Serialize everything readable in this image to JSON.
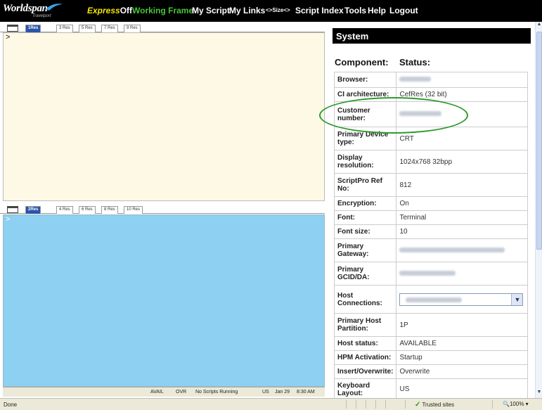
{
  "app": {
    "logo": "Worldspan",
    "logo_sub": "Travelport"
  },
  "nav": {
    "express_prefix": "Express",
    "express_state": "Off",
    "working_frame": "Working Frame",
    "my_script": "My Script",
    "my_links": "My Links",
    "size": "<>Size<>",
    "script_index": "Script Index",
    "tools": "Tools",
    "help": "Help",
    "logout": "Logout"
  },
  "pane1": {
    "tabs": [
      "1Res",
      "3 Res",
      "5 Res",
      "7 Res",
      "9 Res"
    ],
    "caret": ">"
  },
  "pane2": {
    "tabs": [
      "2Res",
      "4 Res",
      "6 Res",
      "8 Res",
      "10 Res"
    ],
    "caret": ">"
  },
  "statusrow": {
    "avail": "AVAIL",
    "ovr": "OVR",
    "scripts": "No Scripts Running",
    "locale": "US",
    "date": "Jan 29",
    "time": "8:30 AM"
  },
  "system": {
    "header": "System",
    "component_heading": "Component:",
    "status_heading": "Status:",
    "rows": [
      {
        "label": "Browser:",
        "value": "",
        "blurred": true
      },
      {
        "label": "CI architecture:",
        "value": "CefRes (32 bit)"
      },
      {
        "label": "Customer number:",
        "value": "",
        "blurred": true
      },
      {
        "label": "Primary Device type:",
        "value": "CRT"
      },
      {
        "label": "Display resolution:",
        "value": "1024x768 32bpp"
      },
      {
        "label": "ScriptPro Ref No:",
        "value": "812"
      },
      {
        "label": "Encryption:",
        "value": "On"
      },
      {
        "label": "Font:",
        "value": "Terminal"
      },
      {
        "label": "Font size:",
        "value": "10"
      },
      {
        "label": "Primary Gateway:",
        "value": "",
        "blurred": true
      },
      {
        "label": "Primary GCID/DA:",
        "value": "",
        "blurred": true
      },
      {
        "label": "Host Connections:",
        "value": "",
        "select": true
      },
      {
        "label": "Primary Host Partition:",
        "value": "1P"
      },
      {
        "label": "Host status:",
        "value": "AVAILABLE"
      },
      {
        "label": "HPM Activation:",
        "value": "Startup"
      },
      {
        "label": "Insert/Overwrite:",
        "value": "Overwrite"
      },
      {
        "label": "Keyboard Layout:",
        "value": "US"
      }
    ]
  },
  "browser_status": {
    "done": "Done",
    "trusted": "Trusted sites",
    "zoom": "100%"
  },
  "colors": {
    "pane1_bg": "#fdf9e5",
    "pane2_bg": "#8dd0f2",
    "working_frame": "#49c43a",
    "express": "#f5e500",
    "highlight_oval": "#2f9a2f"
  }
}
